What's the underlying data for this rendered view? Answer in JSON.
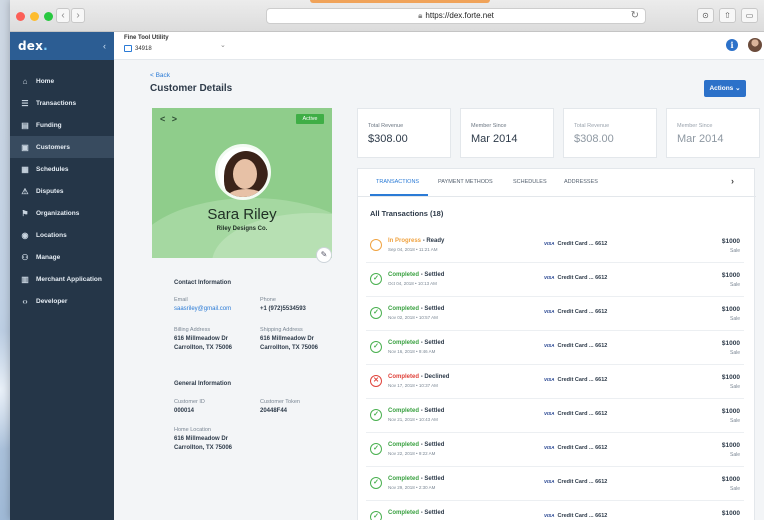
{
  "browser": {
    "url": "https://dex.forte.net"
  },
  "sidebar": {
    "logo_text": "dex",
    "collapse_icon": "chevron-left-icon",
    "items": [
      {
        "label": "Home",
        "icon": "home-icon"
      },
      {
        "label": "Transactions",
        "icon": "transactions-icon"
      },
      {
        "label": "Funding",
        "icon": "funding-icon"
      },
      {
        "label": "Customers",
        "icon": "customers-icon",
        "active": true
      },
      {
        "label": "Schedules",
        "icon": "schedules-icon"
      },
      {
        "label": "Disputes",
        "icon": "disputes-icon"
      },
      {
        "label": "Organizations",
        "icon": "organizations-icon"
      },
      {
        "label": "Locations",
        "icon": "locations-icon"
      },
      {
        "label": "Manage",
        "icon": "manage-icon"
      },
      {
        "label": "Merchant Application",
        "icon": "merchant-icon"
      },
      {
        "label": "Developer",
        "icon": "code-icon"
      }
    ]
  },
  "topbar": {
    "workspace_title": "Fine Tool Utility",
    "workspace_id": "34918"
  },
  "page": {
    "back_label": "< Back",
    "title": "Customer Details",
    "actions_label": "Actions"
  },
  "profile": {
    "nav_arrows": "< >",
    "status_badge": "Active",
    "name": "Sara Riley",
    "company": "Riley Designs Co.",
    "contact_header": "Contact Information",
    "email_label": "Email",
    "email": "saasriley@gmail.com",
    "phone_label": "Phone",
    "phone": "+1 (972)5534593",
    "billing_label": "Billing Address",
    "billing_line1": "616 Millmeadow Dr",
    "billing_line2": "Carrollton, TX 75006",
    "shipping_label": "Shipping Address",
    "shipping_line1": "616 Millmeadow Dr",
    "shipping_line2": "Carrollton, TX 75006",
    "general_header": "General Information",
    "customer_id_label": "Customer ID",
    "customer_id": "000014",
    "token_label": "Customer Token",
    "token": "20448F44",
    "home_location_label": "Home Location",
    "home_line1": "616 Millmeadow Dr",
    "home_line2": "Carrollton, TX 75006"
  },
  "stats": [
    {
      "label": "Total Revenue",
      "value": "$308.00"
    },
    {
      "label": "Member Since",
      "value": "Mar 2014"
    },
    {
      "label": "Total Revenue",
      "value": "$308.00",
      "faded": true
    },
    {
      "label": "Member Since",
      "value": "Mar 2014",
      "faded": true
    }
  ],
  "tabs": [
    "TRANSACTIONS",
    "PAYMENT METHODS",
    "SCHEDULES",
    "ADDRESSES"
  ],
  "transactions_title": "All Transactions (18)",
  "transactions": [
    {
      "status_a": "In Progress",
      "status_b": "- Ready",
      "kind": "pending",
      "date": "Sep 04, 2018 • 11:21 AM",
      "card_brand": "VISA",
      "card": "Credit Card ... 6612",
      "amount": "$1000",
      "type": "Sale"
    },
    {
      "status_a": "Completed",
      "status_b": "- Settled",
      "kind": "ok",
      "date": "Oct 04, 2018 • 10:13 AM",
      "card_brand": "VISA",
      "card": "Credit Card ... 6612",
      "amount": "$1000",
      "type": "Sale"
    },
    {
      "status_a": "Completed",
      "status_b": "- Settled",
      "kind": "ok",
      "date": "Nov 02, 2018 • 10:57 AM",
      "card_brand": "VISA",
      "card": "Credit Card ... 6612",
      "amount": "$1000",
      "type": "Sale"
    },
    {
      "status_a": "Completed",
      "status_b": "- Settled",
      "kind": "ok",
      "date": "Nov 16, 2018 • 9:46 AM",
      "card_brand": "VISA",
      "card": "Credit Card ... 6612",
      "amount": "$1000",
      "type": "Sale"
    },
    {
      "status_a": "Completed",
      "status_b": "- Declined",
      "kind": "declined",
      "date": "Nov 17, 2018 • 10:37 AM",
      "card_brand": "VISA",
      "card": "Credit Card ... 6612",
      "amount": "$1000",
      "type": "Sale"
    },
    {
      "status_a": "Completed",
      "status_b": "- Settled",
      "kind": "ok",
      "date": "Nov 21, 2018 • 10:43 AM",
      "card_brand": "VISA",
      "card": "Credit Card ... 6612",
      "amount": "$1000",
      "type": "Sale"
    },
    {
      "status_a": "Completed",
      "status_b": "- Settled",
      "kind": "ok",
      "date": "Nov 22, 2018 • 9:22 AM",
      "card_brand": "VISA",
      "card": "Credit Card ... 6612",
      "amount": "$1000",
      "type": "Sale"
    },
    {
      "status_a": "Completed",
      "status_b": "- Settled",
      "kind": "ok",
      "date": "Nov 29, 2018 • 2:30 AM",
      "card_brand": "VISA",
      "card": "Credit Card ... 6612",
      "amount": "$1000",
      "type": "Sale"
    },
    {
      "status_a": "Completed",
      "status_b": "- Settled",
      "kind": "ok",
      "date": "Nov 17, 2018 • 9:46 AM",
      "card_brand": "VISA",
      "card": "Credit Card ... 6612",
      "amount": "$1000",
      "type": "Sale"
    }
  ],
  "colors": {
    "sidebar": "#253648",
    "brand_blue": "#2c71c9",
    "success": "#3aa141",
    "pending": "#f0a341",
    "declined": "#e0433b",
    "profile_green": "#8fcd8b"
  }
}
